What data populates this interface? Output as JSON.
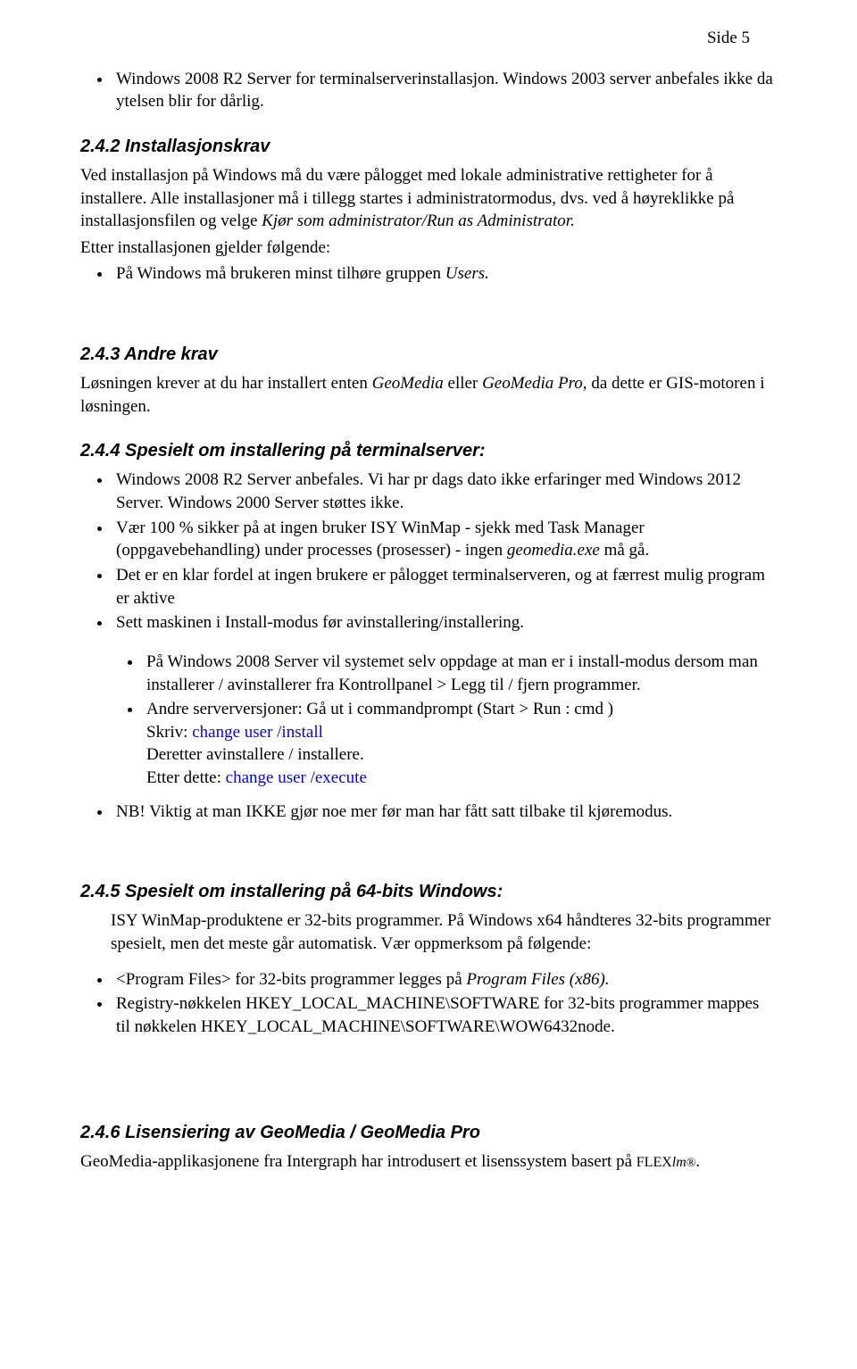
{
  "page_number": "Side 5",
  "intro_bullet": {
    "prefix": "Windows 2008 R2 Server for terminalserverinstallasjon. Windows 2003 server anbefales ikke da ytelsen blir for dårlig."
  },
  "s242": {
    "heading": "2.4.2  Installasjonskrav",
    "p1a": "Ved installasjon på Windows må du være pålogget med lokale administrative rettigheter for å installere. Alle installasjoner må i tillegg startes i administratormodus, dvs. ved å høyreklikke på installasjonsfilen og velge ",
    "p1b": "Kjør som administrator/Run as Administrator.",
    "p2": "Etter installasjonen gjelder følgende:",
    "bullet1a": "På Windows må brukeren minst tilhøre gruppen ",
    "bullet1b": "Users."
  },
  "s243": {
    "heading": "2.4.3  Andre krav",
    "p1a": "Løsningen krever at du har installert enten ",
    "p1b": "GeoMedia ",
    "p1c": "eller ",
    "p1d": "GeoMedia Pro,",
    "p1e": " da dette er GIS-motoren i løsningen."
  },
  "s244": {
    "heading": "2.4.4  Spesielt om installering på terminalserver:",
    "b1": "Windows 2008 R2 Server anbefales. Vi har pr dags dato ikke erfaringer med Windows 2012 Server. Windows 2000 Server støttes ikke.",
    "b2a": "Vær 100 % sikker på at ingen bruker ISY WinMap - sjekk med Task Manager (oppgavebehandling) under processes (prosesser) - ingen ",
    "b2b": "geomedia.exe",
    "b2c": " må gå.",
    "b3": "Det er en klar fordel at ingen brukere er pålogget terminalserveren, og at færrest mulig program er aktive",
    "b4": "Sett maskinen i Install-modus før avinstallering/installering.",
    "nb1": "På Windows 2008 Server vil systemet selv oppdage at man er i install-modus dersom man installerer / avinstallerer fra Kontrollpanel > Legg til / fjern programmer.",
    "nb2a": "Andre serverversjoner: Gå ut i commandprompt (Start  > Run : cmd )",
    "nb2b": "Skriv: ",
    "nb2c": "change user /install",
    "nb2d": "Deretter avinstallere / installere.",
    "nb2e": "Etter dette: ",
    "nb2f": "change user /execute",
    "b5": "NB! Viktig at man IKKE gjør noe mer før man har fått satt tilbake til kjøremodus."
  },
  "s245": {
    "heading": "2.4.5  Spesielt om installering på 64-bits Windows:",
    "p1": "ISY WinMap-produktene er 32-bits programmer. På Windows x64 håndteres 32-bits programmer spesielt, men det meste går automatisk. Vær oppmerksom på følgende:",
    "b1a": "<Program Files> for 32-bits programmer legges på ",
    "b1b": "Program Files (x86).",
    "b2": "Registry-nøkkelen HKEY_LOCAL_MACHINE\\SOFTWARE for 32-bits programmer mappes til nøkkelen HKEY_LOCAL_MACHINE\\SOFTWARE\\WOW6432node."
  },
  "s246": {
    "heading": "2.4.6  Lisensiering av GeoMedia / GeoMedia Pro",
    "p1a": "GeoMedia-applikasjonene fra Intergraph har introdusert et lisenssystem basert på ",
    "p1b": "FLEX",
    "p1c": "lm",
    "p1d": "®",
    "p1e": "."
  }
}
